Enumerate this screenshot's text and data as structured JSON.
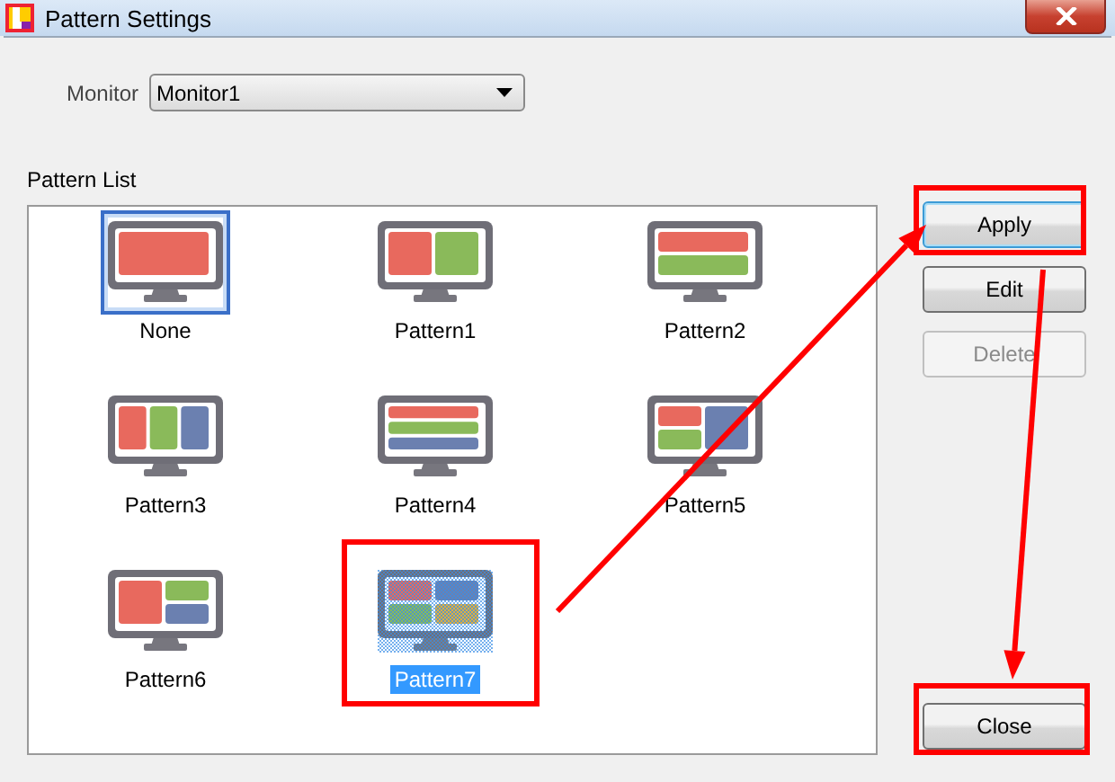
{
  "window": {
    "title": "Pattern Settings"
  },
  "monitor": {
    "label": "Monitor",
    "value": "Monitor1"
  },
  "pattern_list": {
    "label": "Pattern List",
    "items": [
      {
        "label": "None",
        "kind": "single",
        "current": true,
        "selected": false
      },
      {
        "label": "Pattern1",
        "kind": "two-col",
        "current": false,
        "selected": false
      },
      {
        "label": "Pattern2",
        "kind": "two-row",
        "current": false,
        "selected": false
      },
      {
        "label": "Pattern3",
        "kind": "three-col",
        "current": false,
        "selected": false
      },
      {
        "label": "Pattern4",
        "kind": "three-row",
        "current": false,
        "selected": false
      },
      {
        "label": "Pattern5",
        "kind": "big-right",
        "current": false,
        "selected": false
      },
      {
        "label": "Pattern6",
        "kind": "big-left",
        "current": false,
        "selected": false
      },
      {
        "label": "Pattern7",
        "kind": "quad",
        "current": false,
        "selected": true
      }
    ]
  },
  "buttons": [
    {
      "label": "Apply",
      "kind": "top",
      "focused": true,
      "disabled": false
    },
    {
      "label": "Edit",
      "kind": "top",
      "focused": false,
      "disabled": false
    },
    {
      "label": "Delete",
      "kind": "top",
      "focused": false,
      "disabled": true
    },
    {
      "label": "Close",
      "kind": "bottom",
      "focused": false,
      "disabled": false
    }
  ],
  "annotations": [
    {
      "kind": "box"
    },
    {
      "kind": "box"
    },
    {
      "kind": "box"
    },
    {
      "kind": "arrow"
    },
    {
      "kind": "arrow"
    }
  ]
}
